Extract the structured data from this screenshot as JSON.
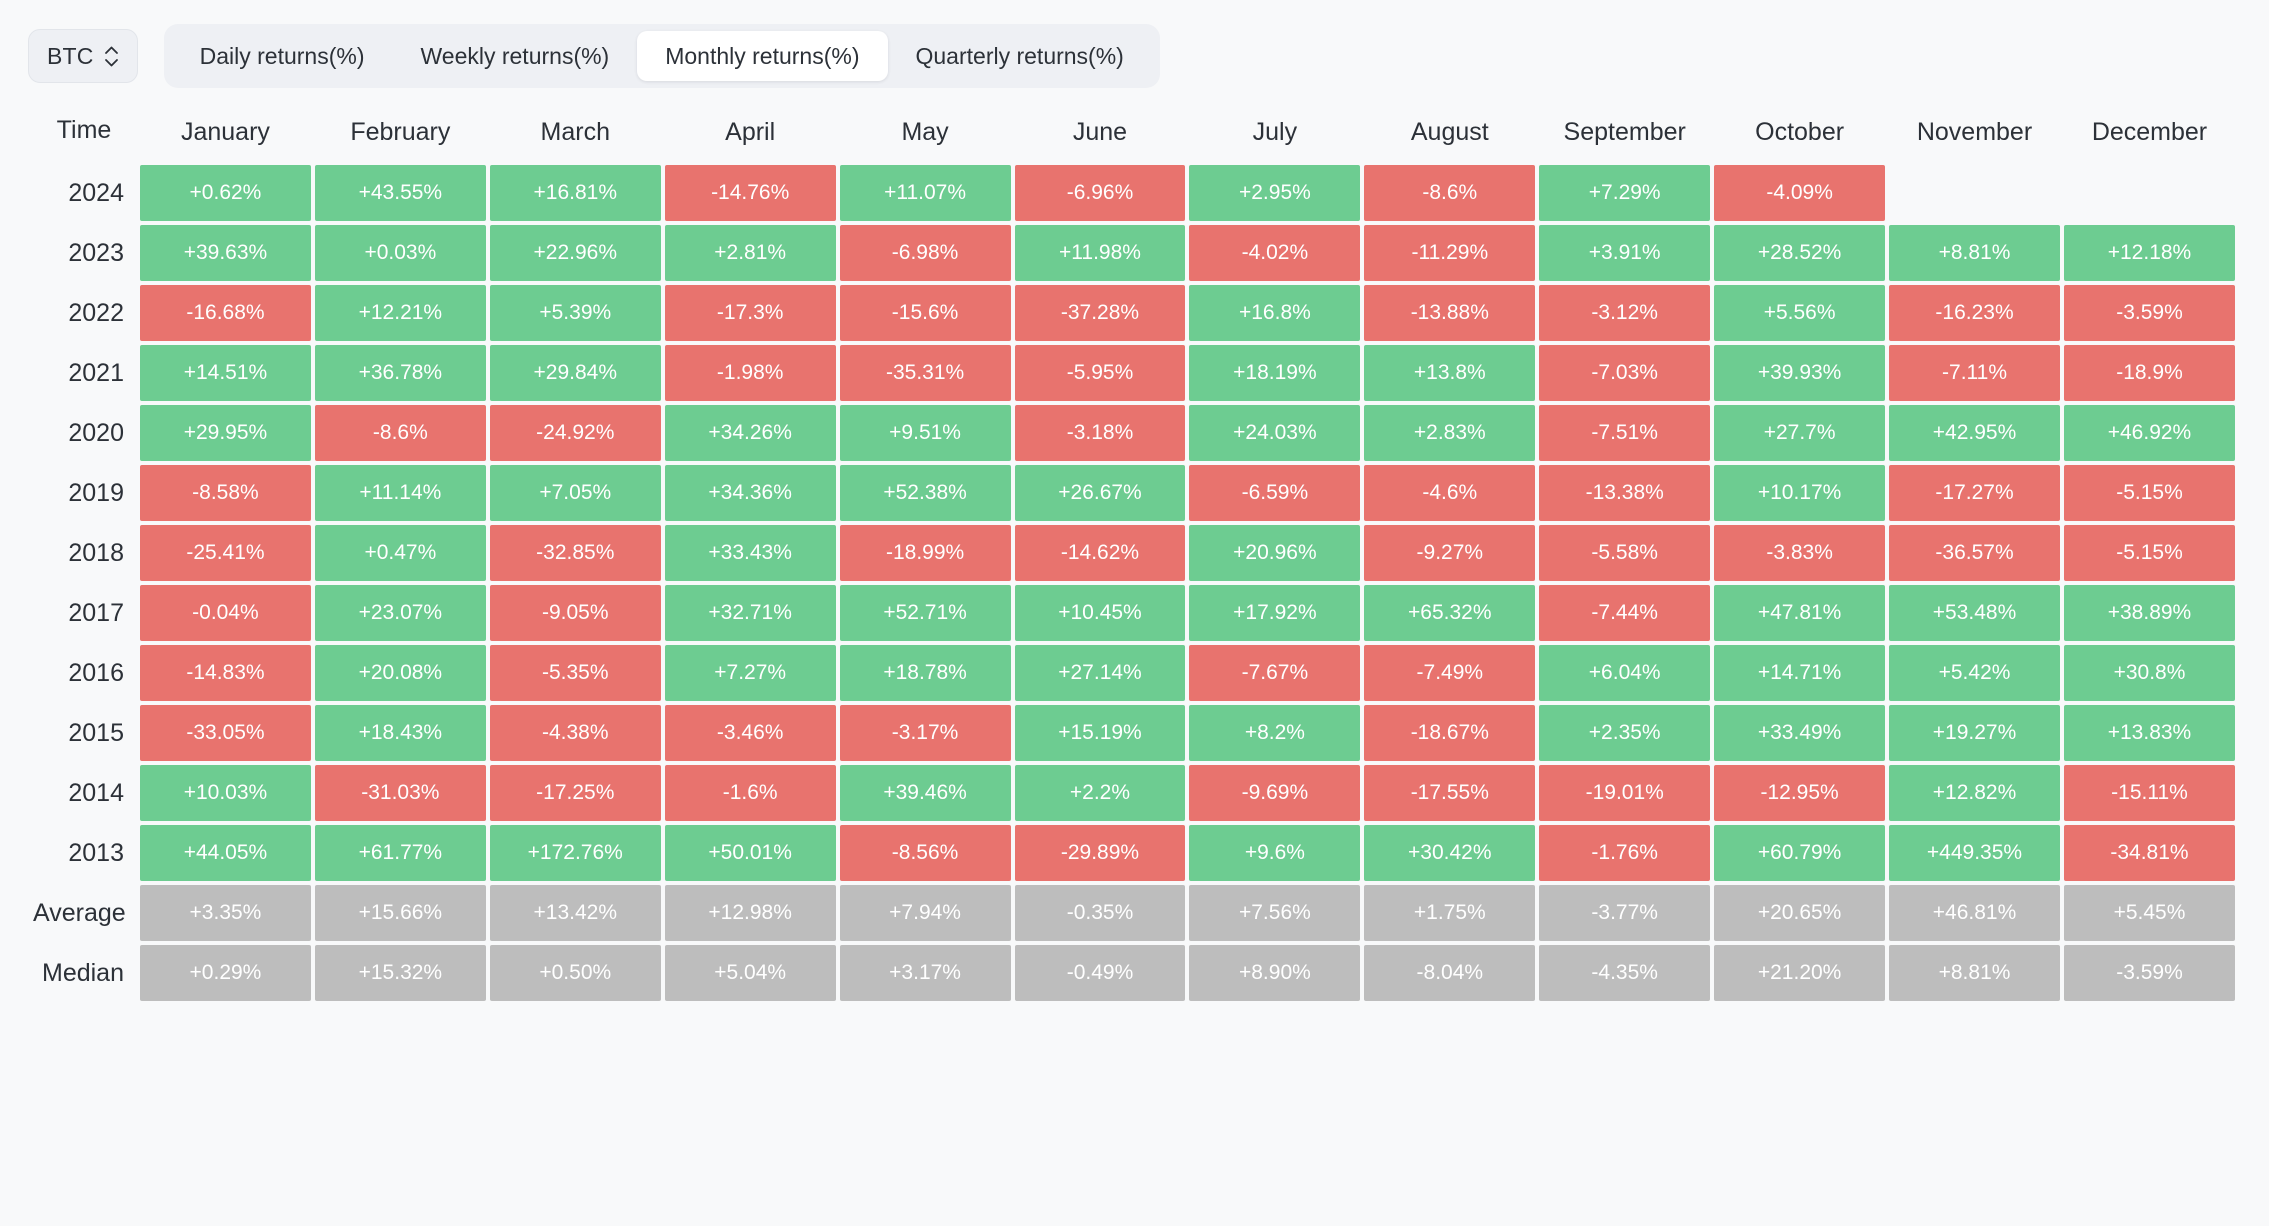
{
  "toolbar": {
    "asset": "BTC",
    "asset_icon": "chevron-up-down-icon",
    "tabs": [
      {
        "label": "Daily returns(%)",
        "active": false
      },
      {
        "label": "Weekly returns(%)",
        "active": false
      },
      {
        "label": "Monthly returns(%)",
        "active": true
      },
      {
        "label": "Quarterly returns(%)",
        "active": false
      }
    ]
  },
  "colors": {
    "positive": "#6dcc91",
    "negative": "#e8736e",
    "summary": "#bdbdbd",
    "page_background": "#f8f9fa",
    "tab_strip": "#eef0f4",
    "active_tab": "#ffffff",
    "text": "#2c3138"
  },
  "table": {
    "time_header": "Time",
    "columns": [
      "January",
      "February",
      "March",
      "April",
      "May",
      "June",
      "July",
      "August",
      "September",
      "October",
      "November",
      "December"
    ],
    "rows": [
      {
        "label": "2024",
        "kind": "year",
        "values": [
          "+0.62%",
          "+43.55%",
          "+16.81%",
          "-14.76%",
          "+11.07%",
          "-6.96%",
          "+2.95%",
          "-8.6%",
          "+7.29%",
          "-4.09%",
          "",
          ""
        ]
      },
      {
        "label": "2023",
        "kind": "year",
        "values": [
          "+39.63%",
          "+0.03%",
          "+22.96%",
          "+2.81%",
          "-6.98%",
          "+11.98%",
          "-4.02%",
          "-11.29%",
          "+3.91%",
          "+28.52%",
          "+8.81%",
          "+12.18%"
        ]
      },
      {
        "label": "2022",
        "kind": "year",
        "values": [
          "-16.68%",
          "+12.21%",
          "+5.39%",
          "-17.3%",
          "-15.6%",
          "-37.28%",
          "+16.8%",
          "-13.88%",
          "-3.12%",
          "+5.56%",
          "-16.23%",
          "-3.59%"
        ]
      },
      {
        "label": "2021",
        "kind": "year",
        "values": [
          "+14.51%",
          "+36.78%",
          "+29.84%",
          "-1.98%",
          "-35.31%",
          "-5.95%",
          "+18.19%",
          "+13.8%",
          "-7.03%",
          "+39.93%",
          "-7.11%",
          "-18.9%"
        ]
      },
      {
        "label": "2020",
        "kind": "year",
        "values": [
          "+29.95%",
          "-8.6%",
          "-24.92%",
          "+34.26%",
          "+9.51%",
          "-3.18%",
          "+24.03%",
          "+2.83%",
          "-7.51%",
          "+27.7%",
          "+42.95%",
          "+46.92%"
        ]
      },
      {
        "label": "2019",
        "kind": "year",
        "values": [
          "-8.58%",
          "+11.14%",
          "+7.05%",
          "+34.36%",
          "+52.38%",
          "+26.67%",
          "-6.59%",
          "-4.6%",
          "-13.38%",
          "+10.17%",
          "-17.27%",
          "-5.15%"
        ]
      },
      {
        "label": "2018",
        "kind": "year",
        "values": [
          "-25.41%",
          "+0.47%",
          "-32.85%",
          "+33.43%",
          "-18.99%",
          "-14.62%",
          "+20.96%",
          "-9.27%",
          "-5.58%",
          "-3.83%",
          "-36.57%",
          "-5.15%"
        ]
      },
      {
        "label": "2017",
        "kind": "year",
        "values": [
          "-0.04%",
          "+23.07%",
          "-9.05%",
          "+32.71%",
          "+52.71%",
          "+10.45%",
          "+17.92%",
          "+65.32%",
          "-7.44%",
          "+47.81%",
          "+53.48%",
          "+38.89%"
        ]
      },
      {
        "label": "2016",
        "kind": "year",
        "values": [
          "-14.83%",
          "+20.08%",
          "-5.35%",
          "+7.27%",
          "+18.78%",
          "+27.14%",
          "-7.67%",
          "-7.49%",
          "+6.04%",
          "+14.71%",
          "+5.42%",
          "+30.8%"
        ]
      },
      {
        "label": "2015",
        "kind": "year",
        "values": [
          "-33.05%",
          "+18.43%",
          "-4.38%",
          "-3.46%",
          "-3.17%",
          "+15.19%",
          "+8.2%",
          "-18.67%",
          "+2.35%",
          "+33.49%",
          "+19.27%",
          "+13.83%"
        ]
      },
      {
        "label": "2014",
        "kind": "year",
        "values": [
          "+10.03%",
          "-31.03%",
          "-17.25%",
          "-1.6%",
          "+39.46%",
          "+2.2%",
          "-9.69%",
          "-17.55%",
          "-19.01%",
          "-12.95%",
          "+12.82%",
          "-15.11%"
        ]
      },
      {
        "label": "2013",
        "kind": "year",
        "values": [
          "+44.05%",
          "+61.77%",
          "+172.76%",
          "+50.01%",
          "-8.56%",
          "-29.89%",
          "+9.6%",
          "+30.42%",
          "-1.76%",
          "+60.79%",
          "+449.35%",
          "-34.81%"
        ]
      },
      {
        "label": "Average",
        "kind": "summary",
        "values": [
          "+3.35%",
          "+15.66%",
          "+13.42%",
          "+12.98%",
          "+7.94%",
          "-0.35%",
          "+7.56%",
          "+1.75%",
          "-3.77%",
          "+20.65%",
          "+46.81%",
          "+5.45%"
        ]
      },
      {
        "label": "Median",
        "kind": "summary",
        "values": [
          "+0.29%",
          "+15.32%",
          "+0.50%",
          "+5.04%",
          "+3.17%",
          "-0.49%",
          "+8.90%",
          "-8.04%",
          "-4.35%",
          "+21.20%",
          "+8.81%",
          "-3.59%"
        ]
      }
    ]
  },
  "chart_data": {
    "type": "heatmap",
    "title": "Monthly returns(%)",
    "asset": "BTC",
    "xlabel": "",
    "ylabel": "Time",
    "categories": [
      "January",
      "February",
      "March",
      "April",
      "May",
      "June",
      "July",
      "August",
      "September",
      "October",
      "November",
      "December"
    ],
    "rows": [
      "2024",
      "2023",
      "2022",
      "2021",
      "2020",
      "2019",
      "2018",
      "2017",
      "2016",
      "2015",
      "2014",
      "2013",
      "Average",
      "Median"
    ],
    "unit": "percent",
    "color_scale": {
      "positive": "#6dcc91",
      "negative": "#e8736e",
      "summary_row": "#bdbdbd"
    },
    "series": [
      {
        "name": "2024",
        "values": [
          0.62,
          43.55,
          16.81,
          -14.76,
          11.07,
          -6.96,
          2.95,
          -8.6,
          7.29,
          -4.09,
          null,
          null
        ]
      },
      {
        "name": "2023",
        "values": [
          39.63,
          0.03,
          22.96,
          2.81,
          -6.98,
          11.98,
          -4.02,
          -11.29,
          3.91,
          28.52,
          8.81,
          12.18
        ]
      },
      {
        "name": "2022",
        "values": [
          -16.68,
          12.21,
          5.39,
          -17.3,
          -15.6,
          -37.28,
          16.8,
          -13.88,
          -3.12,
          5.56,
          -16.23,
          -3.59
        ]
      },
      {
        "name": "2021",
        "values": [
          14.51,
          36.78,
          29.84,
          -1.98,
          -35.31,
          -5.95,
          18.19,
          13.8,
          -7.03,
          39.93,
          -7.11,
          -18.9
        ]
      },
      {
        "name": "2020",
        "values": [
          29.95,
          -8.6,
          -24.92,
          34.26,
          9.51,
          -3.18,
          24.03,
          2.83,
          -7.51,
          27.7,
          42.95,
          46.92
        ]
      },
      {
        "name": "2019",
        "values": [
          -8.58,
          11.14,
          7.05,
          34.36,
          52.38,
          26.67,
          -6.59,
          -4.6,
          -13.38,
          10.17,
          -17.27,
          -5.15
        ]
      },
      {
        "name": "2018",
        "values": [
          -25.41,
          0.47,
          -32.85,
          33.43,
          -18.99,
          -14.62,
          20.96,
          -9.27,
          -5.58,
          -3.83,
          -36.57,
          -5.15
        ]
      },
      {
        "name": "2017",
        "values": [
          -0.04,
          23.07,
          -9.05,
          32.71,
          52.71,
          10.45,
          17.92,
          65.32,
          -7.44,
          47.81,
          53.48,
          38.89
        ]
      },
      {
        "name": "2016",
        "values": [
          -14.83,
          20.08,
          -5.35,
          7.27,
          18.78,
          27.14,
          -7.67,
          -7.49,
          6.04,
          14.71,
          5.42,
          30.8
        ]
      },
      {
        "name": "2015",
        "values": [
          -33.05,
          18.43,
          -4.38,
          -3.46,
          -3.17,
          15.19,
          8.2,
          -18.67,
          2.35,
          33.49,
          19.27,
          13.83
        ]
      },
      {
        "name": "2014",
        "values": [
          10.03,
          -31.03,
          -17.25,
          -1.6,
          39.46,
          2.2,
          -9.69,
          -17.55,
          -19.01,
          -12.95,
          12.82,
          -15.11
        ]
      },
      {
        "name": "2013",
        "values": [
          44.05,
          61.77,
          172.76,
          50.01,
          -8.56,
          -29.89,
          9.6,
          30.42,
          -1.76,
          60.79,
          449.35,
          -34.81
        ]
      },
      {
        "name": "Average",
        "values": [
          3.35,
          15.66,
          13.42,
          12.98,
          7.94,
          -0.35,
          7.56,
          1.75,
          -3.77,
          20.65,
          46.81,
          5.45
        ]
      },
      {
        "name": "Median",
        "values": [
          0.29,
          15.32,
          0.5,
          5.04,
          3.17,
          -0.49,
          8.9,
          -8.04,
          -4.35,
          21.2,
          8.81,
          -3.59
        ]
      }
    ]
  }
}
